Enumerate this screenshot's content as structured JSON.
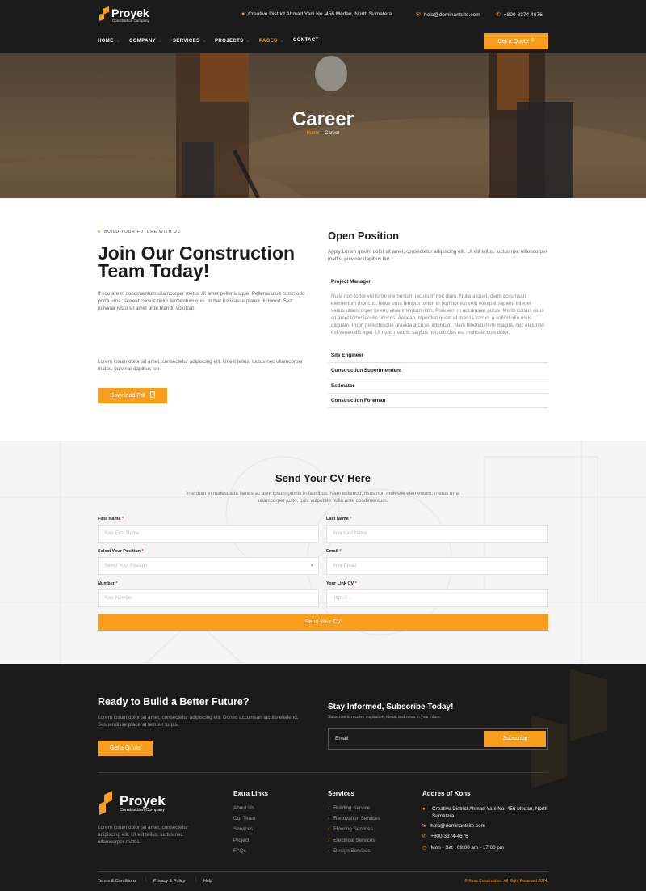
{
  "header": {
    "brand": "Proyek",
    "tagline": "Construction Company",
    "address": "Creative District Ahmad Yani No. 456 Medan, North Sumatera",
    "email": "hola@dominantsite.com",
    "phone": "+800-3374-4676",
    "nav": [
      "HOME",
      "COMPANY",
      "SERVICES",
      "PROJECTS",
      "PAGES",
      "CONTACT"
    ],
    "active_nav": "PAGES",
    "cta": "Get a Quote"
  },
  "hero": {
    "title": "Career",
    "crumb_home": "Home",
    "crumb_sep": "–",
    "crumb_current": "Career"
  },
  "join": {
    "eyebrow": "BUILD YOUR FUTURE WITH US",
    "title": "Join Our Construction Team Today!",
    "para1": "If you are in condimentum ullamcorper metus sit amet pellentesque. Pellentesque commodo porta urna, laoreet cursus dolor fermentum quis. In hac habitasse platea dictumst. Sed pulvinar justo sit amet ante blandit volutpat.",
    "para2": "Lorem ipsum dolor sit amet, consectetur adipiscing elit. Ut elit tellus, luctus nec ullamcorper mattis, pulvinar dapibus leo.",
    "button": "Download Pdf"
  },
  "open": {
    "title": "Open Position",
    "desc": "Apply Lorem ipsum dolor sit amet, consectetur adipiscing elit. Ut elit tellus, luctus nec ullamcorper mattis, pulvinar dapibus leo.",
    "positions": [
      {
        "title": "Project Manager",
        "body": "Nulla non tortor vel tortor elementum iaculis in nec diam. Nulla aliquet, diam accumsan elementum rhoncus, tellus urna tempus tortor, in porttitor est velit volutpat sapien. Integer varius ullamcorper lorem, vitae interdum nibh. Praesent in accumsan purus. Morbi cursus risus sit amet tortor iaculis ultrices. Aenean imperdiet quam et massa varius, a sollicitudin risus aliquam. Proin pellentesque gravida arcu eu interdum. Nam bibendum mi magna, nec euismod est venenatis eget. Ut nunc mauris, sagittis nec ultricies eu, molestie quis dolor."
      },
      {
        "title": "Site Engineer"
      },
      {
        "title": "Construction Superintendent"
      },
      {
        "title": "Estimator"
      },
      {
        "title": "Construction Foreman"
      }
    ]
  },
  "cv": {
    "title": "Send Your CV Here",
    "desc": "Interdum et malesuada fames ac ante ipsum primis in faucibus. Nam euismod, risus non molestie elementum, metus urna ullamcorper justo, quis vulputate nulla ante condimentum.",
    "fields": {
      "first_name": {
        "label": "First Name",
        "placeholder": "Your First Name"
      },
      "last_name": {
        "label": "Last Name",
        "placeholder": "Your Last Name"
      },
      "position": {
        "label": "Select Your Position",
        "placeholder": "Select Your Position"
      },
      "email": {
        "label": "Email",
        "placeholder": "Your Email"
      },
      "number": {
        "label": "Number",
        "placeholder": "Your Number"
      },
      "link_cv": {
        "label": "Your Link CV",
        "placeholder": "https://..."
      }
    },
    "required_mark": "*",
    "button": "Send Your CV"
  },
  "footer": {
    "ready_title": "Ready to Build a Better Future?",
    "ready_text": "Lorem ipsum dolor sit amet, consectetur adipiscing elit. Donec accumsan iaculis eleifend. Suspendisse placerat tempor turpis.",
    "ready_button": "Get a Quote",
    "sub_title": "Stay Informed, Subscribe Today!",
    "sub_text": "Subscribe to receive inspiration, ideas, and news in your inbox.",
    "sub_placeholder": "Email",
    "sub_button": "Subscribe",
    "brand": "Proyek",
    "tagline": "Construction Company",
    "about": "Lorem ipsum dolor sit amet, consectetur adipiscing elit. Ut elit tellus, luctus nec ullamcorper mattis.",
    "extra_title": "Extra Links",
    "extra_links": [
      "About Us",
      "Our Team",
      "Services",
      "Project",
      "FAQs"
    ],
    "services_title": "Services",
    "services": [
      "Building Service",
      "Renovation Services",
      "Flooring Services",
      "Electrical Services",
      "Design Services"
    ],
    "address_title": "Addres of Kons",
    "address": "Creative District Ahmad Yani No. 456 Medan, North Sumatera",
    "email": "hola@dominantsite.com",
    "phone": "+800-3374-4676",
    "hours": "Mon - Sat : 09:00 am - 17:00 pm",
    "bottom_links": [
      "Terms & Conditions",
      "Privacy & Policy",
      "Help"
    ],
    "copyright": "© Kons Construction. All Right Reserved 2024."
  },
  "colors": {
    "accent": "#f99d1c",
    "dark": "#1b1b1b"
  }
}
